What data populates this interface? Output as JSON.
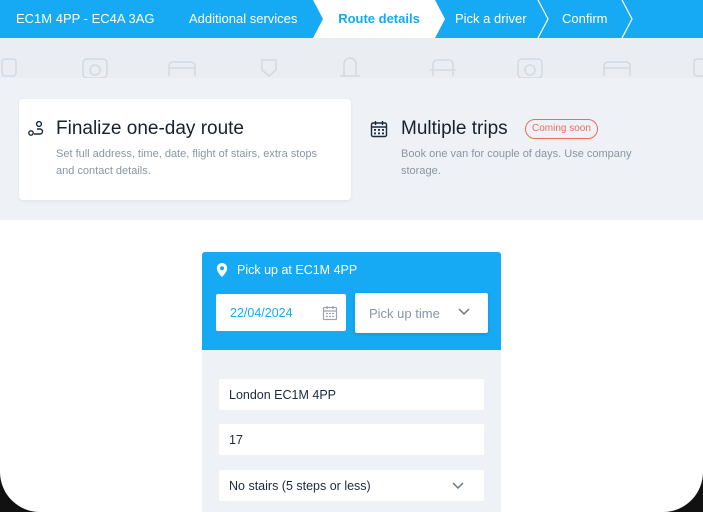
{
  "steps": [
    {
      "label": "EC1M 4PP - EC4A 3AG",
      "state": "done"
    },
    {
      "label": "Additional services",
      "state": "done"
    },
    {
      "label": "Route details",
      "state": "active"
    },
    {
      "label": "Pick a driver",
      "state": "upcoming"
    },
    {
      "label": "Confirm",
      "state": "upcoming"
    }
  ],
  "options": {
    "one_day": {
      "icon": "route-icon",
      "title": "Finalize one-day route",
      "description": "Set full address, time, date, flight of stairs, extra stops and contact details."
    },
    "multiple": {
      "icon": "calendar-icon",
      "title": "Multiple trips",
      "badge": "Coming soon",
      "description": "Book one van for couple of days. Use company storage."
    }
  },
  "pickup": {
    "title": "Pick up at EC1M 4PP",
    "date": "22/04/2024",
    "time_placeholder": "Pick up time",
    "address": "London EC1M 4PP",
    "number": "17",
    "stairs": "No stairs (5 steps or less)"
  },
  "colors": {
    "brand_blue": "#16a9f4",
    "badge_red": "#ef6b5e",
    "panel_bg": "#eef2f6"
  }
}
